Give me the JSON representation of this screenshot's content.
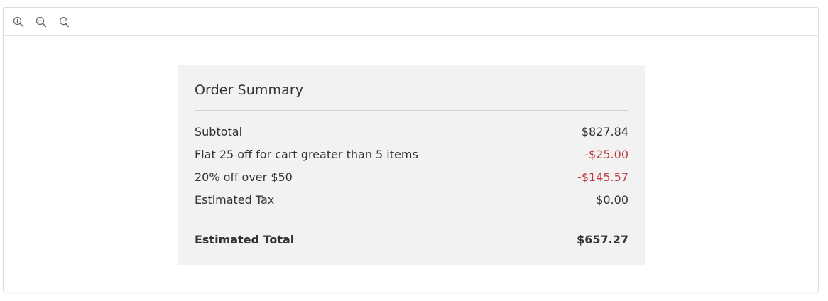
{
  "toolbar": {
    "zoom_in_icon": "zoom-in-icon",
    "zoom_out_icon": "zoom-out-icon",
    "reset_icon": "reset-zoom-icon"
  },
  "order_summary": {
    "title": "Order Summary",
    "lines": [
      {
        "label": "Subtotal",
        "value": "$827.84"
      },
      {
        "label": "Flat 25 off for cart greater than 5 items",
        "value": "-$25.00"
      },
      {
        "label": "20% off over $50",
        "value": "-$145.57"
      },
      {
        "label": "Estimated Tax",
        "value": "$0.00"
      }
    ],
    "total": {
      "label": "Estimated Total",
      "value": "$657.27"
    }
  },
  "colors": {
    "discount": "#c0393b",
    "panel_background": "#f2f2f2",
    "text": "#333333"
  }
}
